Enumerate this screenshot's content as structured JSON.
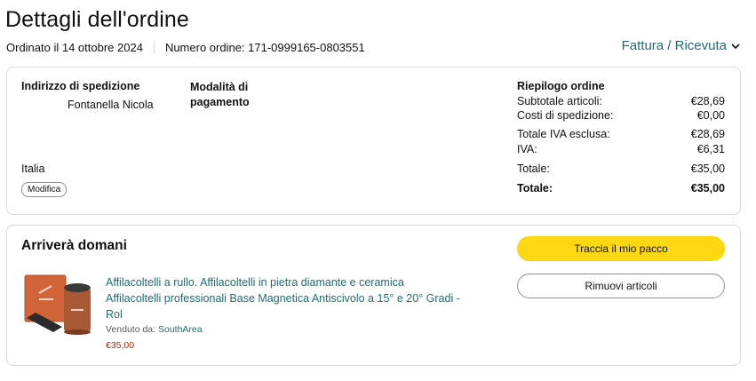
{
  "header": {
    "title": "Dettagli dell'ordine",
    "ordered": "Ordinato il 14 ottobre 2024",
    "order_number": "Numero ordine: 171-0999165-0803551",
    "invoice_link": "Fattura / Ricevuta"
  },
  "shipping": {
    "label": "Indirizzo di spedizione",
    "name": "Fontanella Nicola",
    "country": "Italia",
    "modify": "Modifica"
  },
  "payment": {
    "label_line1": "Modalità di",
    "label_line2": "pagamento"
  },
  "summary": {
    "title": "Riepilogo ordine",
    "rows": [
      {
        "label": "Subtotale articoli:",
        "value": "€28,69"
      },
      {
        "label": "Costi di spedizione:",
        "value": "€0,00"
      },
      {
        "label": "Totale IVA esclusa:",
        "value": "€28,69"
      },
      {
        "label": "IVA:",
        "value": "€6,31"
      },
      {
        "label": "Totale:",
        "value": "€35,00"
      },
      {
        "label": "Totale:",
        "value": "€35,00"
      }
    ]
  },
  "delivery": {
    "status": "Arriverà domani",
    "track_button": "Traccia il mio pacco",
    "remove_button": "Rimuovi articoli",
    "product": {
      "name_line1": "Affilacoltelli a rullo. Affilacoltelli in pietra diamante e ceramica",
      "name_line2": "Affilacoltelli professionali Base Magnetica Antiscivolo a 15° e 20° Gradi -",
      "name_line3": "Rol",
      "sold_by_label": "Venduto da:",
      "seller": "SouthArea",
      "price": "€35,00"
    }
  },
  "colors": {
    "link": "#1c6e73",
    "price": "#b12704",
    "primary_button": "#ffd814",
    "border": "#d5d9d9"
  }
}
